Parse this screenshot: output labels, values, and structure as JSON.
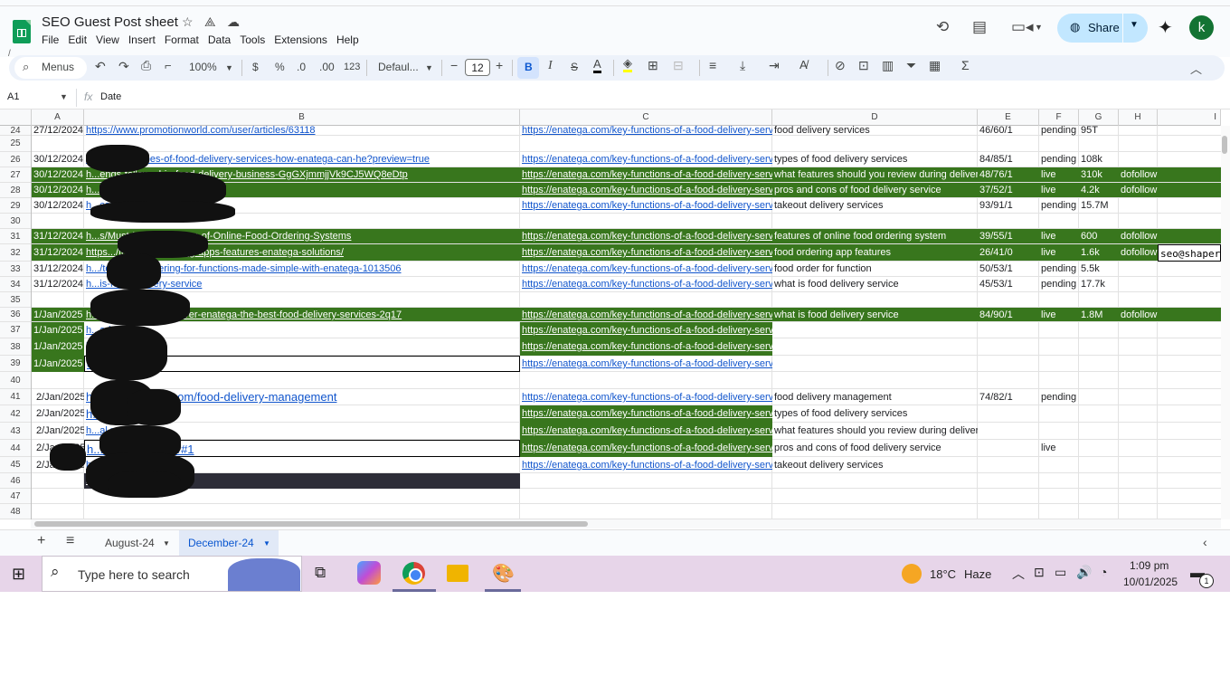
{
  "doc": {
    "title": "SEO Guest Post sheet",
    "menus": [
      "File",
      "Edit",
      "View",
      "Insert",
      "Format",
      "Data",
      "Tools",
      "Extensions",
      "Help"
    ],
    "share_label": "Share",
    "avatar_letter": "k"
  },
  "toolbar": {
    "menus_label": "Menus",
    "zoom": "100%",
    "currency": "$",
    "percent": "%",
    "dec_less": ".0",
    "dec_more": ".00",
    "num_format": "123",
    "font": "Defaul...",
    "font_size": "12",
    "bold": "B",
    "italic": "I",
    "strike": "S",
    "text_color": "A"
  },
  "formula_bar": {
    "cell_ref": "A1",
    "fx": "fx",
    "value": "Date"
  },
  "columns": [
    "A",
    "B",
    "C",
    "D",
    "E",
    "F",
    "G",
    "H",
    "I"
  ],
  "rows": [
    {
      "n": "24",
      "date": "27/12/2024",
      "b": "https://www.promotionworld.com/user/articles/63118",
      "c": "https://enatega.com/key-functions-of-a-food-delivery-service",
      "d": "food delivery services",
      "e": "46/60/1",
      "f": "pending",
      "g": "95T",
      "h": "",
      "i": ""
    },
    {
      "n": "25",
      "date": "",
      "b": "",
      "c": "",
      "d": "",
      "e": "",
      "f": "",
      "g": "",
      "h": "",
      "i": ""
    },
    {
      "n": "26",
      "date": "30/12/2024",
      "b": "ht...articles/types-of-food-delivery-services-how-enatega-can-he?preview=true",
      "c": "https://enatega.com/key-functions-of-a-food-delivery-service",
      "d": "types of food delivery services",
      "e": "84/85/1",
      "f": "pending",
      "g": "108k",
      "h": "",
      "i": ""
    },
    {
      "n": "27",
      "date": "30/12/2024",
      "b": "h...ends-followed-in-food-delivery-business-GgGXjmmjjVk9CJ5WQ8eDtp",
      "c": "https://enatega.com/key-functions-of-a-food-delivery-service",
      "d": "what features should you review during delivery?",
      "e": "48/76/1",
      "f": "live",
      "g": "310k",
      "h": "dofollow",
      "i": ""
    },
    {
      "n": "28",
      "date": "30/12/2024",
      "b": "h...com/read-blog/21782",
      "c": "https://enatega.com/key-functions-of-a-food-delivery-service",
      "d": "pros and cons of food delivery service",
      "e": "37/52/1",
      "f": "live",
      "g": "4.2k",
      "h": "dofollow",
      "i": ""
    },
    {
      "n": "29",
      "date": "30/12/2024",
      "b": "h...com/post?id=7806172",
      "c": "https://enatega.com/key-functions-of-a-food-delivery-service",
      "d": "takeout delivery services",
      "e": "93/91/1",
      "f": "pending",
      "g": "15.7M",
      "h": "",
      "i": ""
    },
    {
      "n": "30",
      "date": "",
      "b": "",
      "c": "",
      "d": "",
      "e": "",
      "f": "",
      "g": "",
      "h": "",
      "i": ""
    },
    {
      "n": "31",
      "date": "31/12/2024",
      "b": "h...s/Must-Have-Features-of-Online-Food-Ordering-Systems",
      "c": "https://enatega.com/key-functions-of-a-food-delivery-service",
      "d": "features of online food ordering system",
      "e": "39/55/1",
      "f": "live",
      "g": "600",
      "h": "dofollow",
      "i": ""
    },
    {
      "n": "32",
      "date": "31/12/2024",
      "b": "https.../top-food-ordering-apps-features-enatega-solutions/",
      "c": "https://enatega.com/key-functions-of-a-food-delivery-service",
      "d": "food ordering app features",
      "e": "26/41/0",
      "f": "live",
      "g": "1.6k",
      "h": "dofollow",
      "i": "seo@shaper"
    },
    {
      "n": "33",
      "date": "31/12/2024",
      "b": "h.../text/food-ordering-for-functions-made-simple-with-enatega-1013506",
      "c": "https://enatega.com/key-functions-of-a-food-delivery-service",
      "d": "food order for function",
      "e": "50/53/1",
      "f": "pending",
      "g": "5.5k",
      "h": "",
      "i": ""
    },
    {
      "n": "34",
      "date": "31/12/2024",
      "b": "h...is-food-delivery-service",
      "c": "https://enatega.com/key-functions-of-a-food-delivery-service",
      "d": "what is food delivery service",
      "e": "45/53/1",
      "f": "pending",
      "g": "17.7k",
      "h": "",
      "i": ""
    },
    {
      "n": "35",
      "date": "",
      "b": "",
      "c": "",
      "d": "",
      "e": "",
      "f": "",
      "g": "",
      "h": "",
      "i": ""
    },
    {
      "n": "36",
      "date": "1/Jan/2025",
      "b": "h...d/0dd3b569a/discover-enatega-the-best-food-delivery-services-2q17",
      "c": "https://enatega.com/key-functions-of-a-food-delivery-service",
      "d": "what is food delivery service",
      "e": "84/90/1",
      "f": "live",
      "g": "1.8M",
      "h": "dofollow",
      "i": ""
    },
    {
      "n": "37",
      "date": "1/Jan/2025",
      "b": "h...admin",
      "c": "https://enatega.com/key-functions-of-a-food-delivery-service",
      "d": "",
      "e": "",
      "f": "",
      "g": "",
      "h": "",
      "i": ""
    },
    {
      "n": "38",
      "date": "1/Jan/2025",
      "b": "h...tb",
      "c": "https://enatega.com/key-functions-of-a-food-delivery-service",
      "d": "",
      "e": "",
      "f": "",
      "g": "",
      "h": "",
      "i": ""
    },
    {
      "n": "39",
      "date": "1/Jan/2025",
      "b": "c...n",
      "c": "https://enatega.com/key-functions-of-a-food-delivery-service",
      "d": "",
      "e": "",
      "f": "",
      "g": "",
      "h": "",
      "i": ""
    },
    {
      "n": "40",
      "date": "",
      "b": "",
      "c": "",
      "d": "",
      "e": "",
      "f": "",
      "g": "",
      "h": "",
      "i": ""
    },
    {
      "n": "41",
      "date": "2/Jan/2025",
      "b": "h...s.newsbreak.com/food-delivery-management",
      "c": "https://enatega.com/key-functions-of-a-food-delivery-service",
      "d": "food delivery management",
      "e": "74/82/1",
      "f": "pending",
      "g": "",
      "h": "",
      "i": ""
    },
    {
      "n": "42",
      "date": "2/Jan/2025",
      "b": "h...ymix.com/",
      "c": "https://enatega.com/key-functions-of-a-food-delivery-service",
      "d": "types of food delivery services",
      "e": "",
      "f": "",
      "g": "",
      "h": "",
      "i": ""
    },
    {
      "n": "43",
      "date": "2/Jan/2025",
      "b": "h...al.net/",
      "c": "https://enatega.com/key-functions-of-a-food-delivery-service",
      "d": "what features should you review during delivery?",
      "e": "",
      "f": "",
      "g": "",
      "h": "",
      "i": ""
    },
    {
      "n": "44",
      "date": "2/Jan/2025",
      "b": "h...a.com/739462/#1",
      "c": "https://enatega.com/key-functions-of-a-food-delivery-service",
      "d": "pros and cons of food delivery service",
      "e": "",
      "f": "live",
      "g": "",
      "h": "",
      "i": ""
    },
    {
      "n": "45",
      "date": "2/Jan/2025",
      "b": "h...com",
      "c": "https://enatega.com/key-functions-of-a-food-delivery-service",
      "d": "takeout delivery services",
      "e": "",
      "f": "",
      "g": "",
      "h": "",
      "i": ""
    },
    {
      "n": "46",
      "date": "",
      "b": "h...e.com/",
      "c": "",
      "d": "",
      "e": "",
      "f": "",
      "g": "",
      "h": "",
      "i": ""
    },
    {
      "n": "47",
      "date": "",
      "b": "",
      "c": "",
      "d": "",
      "e": "",
      "f": "",
      "g": "",
      "h": "",
      "i": ""
    },
    {
      "n": "48",
      "date": "",
      "b": "",
      "c": "",
      "d": "",
      "e": "",
      "f": "",
      "g": "",
      "h": "",
      "i": ""
    }
  ],
  "tabs": {
    "add": "+",
    "list": "≡",
    "sheet1": "August-24",
    "sheet2": "December-24"
  },
  "taskbar": {
    "search_placeholder": "Type here to search",
    "temp": "18°C",
    "weather": "Haze",
    "time": "1:09 pm",
    "date": "10/01/2025",
    "notif_count": "1"
  },
  "colors": {
    "green_fill": "#38761d",
    "link": "#1155cc",
    "share_bg": "#c2e7ff"
  }
}
